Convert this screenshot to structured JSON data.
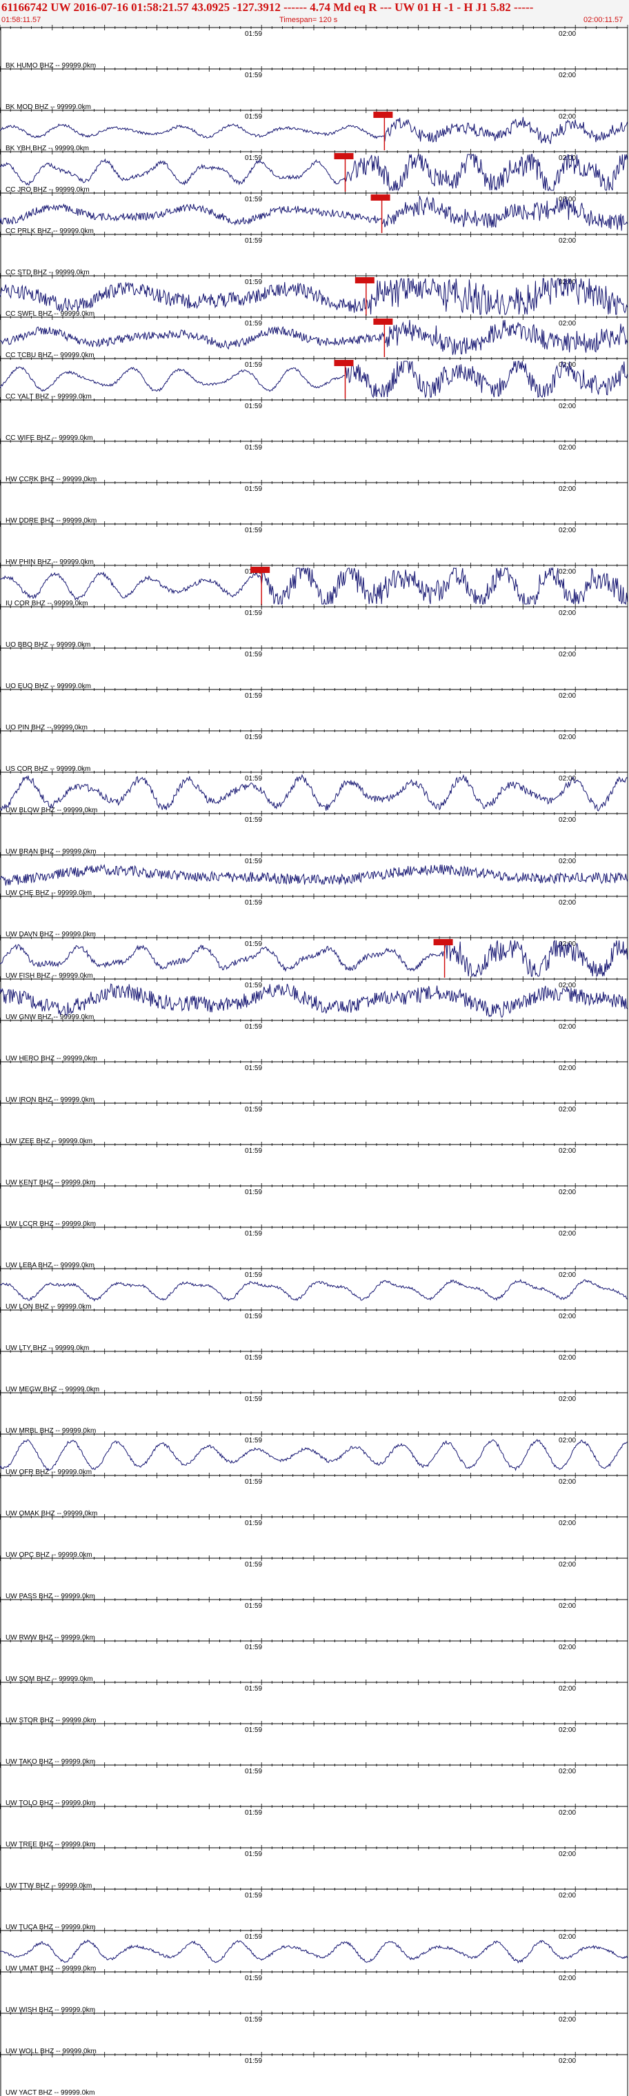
{
  "header": {
    "title": "61166742 UW 2016-07-16 01:58:21.57   43.0925 -127.3912 ------ 4.74 Md  eq  R ---     UW 01  H  -1  -  H J1    5.82 -----",
    "start_time": "01:58:11.57",
    "timespan": "Timespan= 120 s",
    "end_time": "02:00:11.57"
  },
  "chart_data": {
    "type": "line",
    "title": "61166742 UW 2016-07-16 01:58:21.57   43.0925 -127.3912 ------ 4.74 Md  eq  R ---     UW 01  H  -1  -  H J1    5.82 -----",
    "xlim_seconds": [
      0,
      120
    ],
    "time_labels": [
      {
        "label": "01:59",
        "t": 48.4
      },
      {
        "label": "02:00",
        "t": 108.4
      }
    ],
    "traces": [
      {
        "name": "BK HUMO BHZ -- 99999.0km",
        "amp": 0,
        "noise": 0,
        "lp": 0,
        "pick": null
      },
      {
        "name": "BK MOD BHZ -- 99999.0km",
        "amp": 0,
        "noise": 0,
        "lp": 0,
        "pick": null
      },
      {
        "name": "BK YBH BHZ -- 99999.0km",
        "amp": 0.18,
        "noise": 0.2,
        "lp": 0.9,
        "pick": 73.5
      },
      {
        "name": "CC JRO BHZ -- 99999.0km",
        "amp": 0.55,
        "noise": 0.15,
        "lp": 1.0,
        "pick": 66
      },
      {
        "name": "CC PRLK BHZ -- 99999.0km",
        "amp": 0.35,
        "noise": 0.4,
        "lp": 0.5,
        "pick": 73
      },
      {
        "name": "CC STD BHZ -- 99999.0km",
        "amp": 0,
        "noise": 0,
        "lp": 0,
        "pick": null
      },
      {
        "name": "CC SWFL BHZ -- 99999.0km",
        "amp": 0.6,
        "noise": 0.55,
        "lp": 0.35,
        "pick": 70
      },
      {
        "name": "CC TCBU BHZ -- 99999.0km",
        "amp": 0.35,
        "noise": 0.45,
        "lp": 0.45,
        "pick": 73.5
      },
      {
        "name": "CC YALT BHZ -- 99999.0km",
        "amp": 0.55,
        "noise": 0.1,
        "lp": 1.0,
        "pick": 66
      },
      {
        "name": "CC WIFE BHZ -- 99999.0km",
        "amp": 0,
        "noise": 0,
        "lp": 0,
        "pick": null
      },
      {
        "name": "HW CCRK BHZ -- 99999.0km",
        "amp": 0,
        "noise": 0,
        "lp": 0,
        "pick": null
      },
      {
        "name": "HW DDRE BHZ -- 99999.0km",
        "amp": 0,
        "noise": 0,
        "lp": 0,
        "pick": null
      },
      {
        "name": "HW PHIN BHZ -- 99999.0km",
        "amp": 0,
        "noise": 0,
        "lp": 0,
        "pick": null
      },
      {
        "name": "IU COR BHZ -- 99999.0km",
        "amp": 0.65,
        "noise": 0.15,
        "lp": 1.0,
        "pick": 50
      },
      {
        "name": "UO BBO BHZ -- 99999.0km",
        "amp": 0,
        "noise": 0,
        "lp": 0,
        "pick": null
      },
      {
        "name": "UO EUO BHZ -- 99999.0km",
        "amp": 0,
        "noise": 0,
        "lp": 0,
        "pick": null
      },
      {
        "name": "UO PIN BHZ -- 99999.0km",
        "amp": 0,
        "noise": 0,
        "lp": 0,
        "pick": null
      },
      {
        "name": "US COR BHZ -- 99999.0km",
        "amp": 0,
        "noise": 0,
        "lp": 0,
        "pick": null
      },
      {
        "name": "UW BLOW BHZ -- 99999.0km",
        "amp": 0.85,
        "noise": 0.2,
        "lp": 1.0,
        "pick": null
      },
      {
        "name": "UW BRAN BHZ -- 99999.0km",
        "amp": 0,
        "noise": 0,
        "lp": 0,
        "pick": null
      },
      {
        "name": "UW CHE BHZ -- 99999.0km",
        "amp": 0.3,
        "noise": 0.6,
        "lp": 0.2,
        "pick": null
      },
      {
        "name": "UW DAVN BHZ -- 99999.0km",
        "amp": 0,
        "noise": 0,
        "lp": 0,
        "pick": null
      },
      {
        "name": "UW FISH BHZ -- 99999.0km",
        "amp": 0.6,
        "noise": 0.2,
        "lp": 1.0,
        "pick": 85
      },
      {
        "name": "UW GNW BHZ -- 99999.0km",
        "amp": 0.65,
        "noise": 0.55,
        "lp": 0.4,
        "pick": null
      },
      {
        "name": "UW HERO BHZ -- 99999.0km",
        "amp": 0,
        "noise": 0,
        "lp": 0,
        "pick": null
      },
      {
        "name": "UW IRON BHZ -- 99999.0km",
        "amp": 0,
        "noise": 0,
        "lp": 0,
        "pick": null
      },
      {
        "name": "UW IZEE BHZ -- 99999.0km",
        "amp": 0,
        "noise": 0,
        "lp": 0,
        "pick": null
      },
      {
        "name": "UW KENT BHZ -- 99999.0km",
        "amp": 0,
        "noise": 0,
        "lp": 0,
        "pick": null
      },
      {
        "name": "UW LCCR BHZ -- 99999.0km",
        "amp": 0,
        "noise": 0,
        "lp": 0,
        "pick": null
      },
      {
        "name": "UW LEBA BHZ -- 99999.0km",
        "amp": 0,
        "noise": 0,
        "lp": 0,
        "pick": null
      },
      {
        "name": "UW LON BHZ -- 99999.0km",
        "amp": 0.45,
        "noise": 0.12,
        "lp": 1.0,
        "pick": null
      },
      {
        "name": "UW LTY BHZ -- 99999.0km",
        "amp": 0,
        "noise": 0,
        "lp": 0,
        "pick": null
      },
      {
        "name": "UW MEGW BHZ -- 99999.0km",
        "amp": 0,
        "noise": 0,
        "lp": 0,
        "pick": null
      },
      {
        "name": "UW MRBL BHZ -- 99999.0km",
        "amp": 0,
        "noise": 0,
        "lp": 0,
        "pick": null
      },
      {
        "name": "UW OFR BHZ -- 99999.0km",
        "amp": 0.7,
        "noise": 0.1,
        "lp": 1.0,
        "pick": null
      },
      {
        "name": "UW OMAK BHZ -- 99999.0km",
        "amp": 0,
        "noise": 0,
        "lp": 0,
        "pick": null
      },
      {
        "name": "UW OPC BHZ -- 99999.0km",
        "amp": 0,
        "noise": 0,
        "lp": 0,
        "pick": null
      },
      {
        "name": "UW PASS BHZ -- 99999.0km",
        "amp": 0,
        "noise": 0,
        "lp": 0,
        "pick": null
      },
      {
        "name": "UW RWW BHZ -- 99999.0km",
        "amp": 0,
        "noise": 0,
        "lp": 0,
        "pick": null
      },
      {
        "name": "UW SQM BHZ -- 99999.0km",
        "amp": 0,
        "noise": 0,
        "lp": 0,
        "pick": null
      },
      {
        "name": "UW STOR BHZ -- 99999.0km",
        "amp": 0,
        "noise": 0,
        "lp": 0,
        "pick": null
      },
      {
        "name": "UW TAKO BHZ -- 99999.0km",
        "amp": 0,
        "noise": 0,
        "lp": 0,
        "pick": null
      },
      {
        "name": "UW TOLO BHZ -- 99999.0km",
        "amp": 0,
        "noise": 0,
        "lp": 0,
        "pick": null
      },
      {
        "name": "UW TREE BHZ -- 99999.0km",
        "amp": 0,
        "noise": 0,
        "lp": 0,
        "pick": null
      },
      {
        "name": "UW TTW BHZ -- 99999.0km",
        "amp": 0,
        "noise": 0,
        "lp": 0,
        "pick": null
      },
      {
        "name": "UW TUCA BHZ -- 99999.0km",
        "amp": 0,
        "noise": 0,
        "lp": 0,
        "pick": null
      },
      {
        "name": "UW UMAT BHZ -- 99999.0km",
        "amp": 0.45,
        "noise": 0.12,
        "lp": 1.0,
        "pick": null
      },
      {
        "name": "UW WISH BHZ -- 99999.0km",
        "amp": 0,
        "noise": 0,
        "lp": 0,
        "pick": null
      },
      {
        "name": "UW WOLL BHZ -- 99999.0km",
        "amp": 0,
        "noise": 0,
        "lp": 0,
        "pick": null
      },
      {
        "name": "UW YACT BHZ -- 99999.0km",
        "amp": 0,
        "noise": 0,
        "lp": 0,
        "pick": null
      }
    ]
  },
  "colors": {
    "header_text": "#d01010",
    "trace": "#141470",
    "pick": "#d01010",
    "axis": "#000000"
  }
}
